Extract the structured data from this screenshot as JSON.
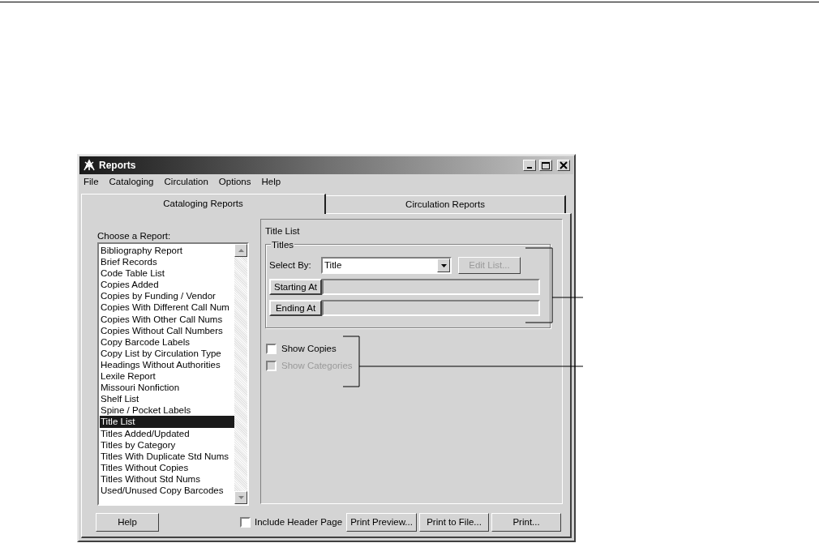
{
  "window": {
    "title": "Reports"
  },
  "menu": [
    "File",
    "Cataloging",
    "Circulation",
    "Options",
    "Help"
  ],
  "tabs": [
    {
      "label": "Cataloging Reports",
      "selected": true
    },
    {
      "label": "Circulation Reports",
      "selected": false
    }
  ],
  "report_list": {
    "label": "Choose a Report:",
    "items": [
      {
        "label": "Bibliography Report",
        "selected": false
      },
      {
        "label": "Brief Records",
        "selected": false
      },
      {
        "label": "Code Table List",
        "selected": false
      },
      {
        "label": "Copies Added",
        "selected": false
      },
      {
        "label": "Copies by Funding / Vendor",
        "selected": false
      },
      {
        "label": "Copies With Different Call Num",
        "selected": false
      },
      {
        "label": "Copies With Other Call Nums",
        "selected": false
      },
      {
        "label": "Copies Without Call Numbers",
        "selected": false
      },
      {
        "label": "Copy Barcode Labels",
        "selected": false
      },
      {
        "label": "Copy List by Circulation Type",
        "selected": false
      },
      {
        "label": "Headings Without Authorities",
        "selected": false
      },
      {
        "label": "Lexile Report",
        "selected": false
      },
      {
        "label": "Missouri Nonfiction",
        "selected": false
      },
      {
        "label": "Shelf List",
        "selected": false
      },
      {
        "label": "Spine / Pocket Labels",
        "selected": false
      },
      {
        "label": "Title List",
        "selected": true
      },
      {
        "label": "Titles Added/Updated",
        "selected": false
      },
      {
        "label": "Titles by Category",
        "selected": false
      },
      {
        "label": "Titles With Duplicate Std Nums",
        "selected": false
      },
      {
        "label": "Titles Without Copies",
        "selected": false
      },
      {
        "label": "Titles Without Std Nums",
        "selected": false
      },
      {
        "label": "Used/Unused Copy Barcodes",
        "selected": false
      }
    ]
  },
  "report_panel": {
    "title": "Title List",
    "group": {
      "title": "Titles",
      "select_by": {
        "label": "Select By:",
        "value": "Title"
      },
      "edit_list": {
        "label": "Edit List...",
        "disabled": true
      },
      "range": [
        {
          "label": "Starting At"
        },
        {
          "label": "Ending At"
        }
      ]
    },
    "options": [
      {
        "label": "Show Copies",
        "checked": false,
        "disabled": false
      },
      {
        "label": "Show Categories",
        "checked": false,
        "disabled": true
      }
    ]
  },
  "footer": {
    "help": "Help",
    "include_header": {
      "label": "Include Header Page",
      "checked": false
    },
    "buttons": [
      "Print Preview...",
      "Print to File...",
      "Print..."
    ]
  }
}
